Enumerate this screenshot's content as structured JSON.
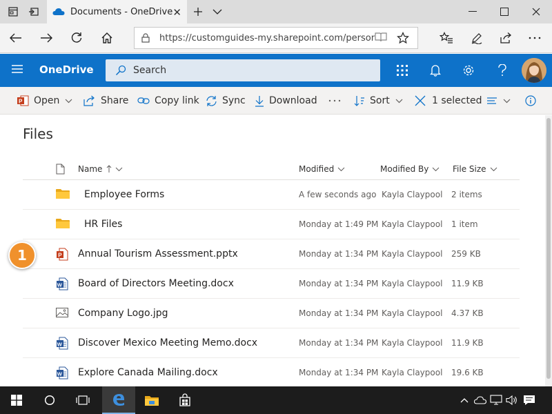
{
  "browser": {
    "tab_title": "Documents - OneDrive",
    "url": "https://customguides-my.sharepoint.com/personal/s"
  },
  "suite": {
    "app_name": "OneDrive",
    "search_placeholder": "Search"
  },
  "commands": {
    "open": "Open",
    "share": "Share",
    "copy_link": "Copy link",
    "sync": "Sync",
    "download": "Download",
    "sort": "Sort",
    "selected": "1 selected"
  },
  "page": {
    "title": "Files"
  },
  "columns": {
    "name": "Name",
    "modified": "Modified",
    "modified_by": "Modified By",
    "file_size": "File Size"
  },
  "files": [
    {
      "name": "Employee Forms",
      "modified": "A few seconds ago",
      "by": "Kayla Claypool",
      "size": "2 items",
      "icon": "folder-icon"
    },
    {
      "name": "HR Files",
      "modified": "Monday at 1:49 PM",
      "by": "Kayla Claypool",
      "size": "1 item",
      "icon": "folder-icon"
    },
    {
      "name": "Annual Tourism Assessment.pptx",
      "modified": "Monday at 1:34 PM",
      "by": "Kayla Claypool",
      "size": "259 KB",
      "icon": "powerpoint-file-icon"
    },
    {
      "name": "Board of Directors Meeting.docx",
      "modified": "Monday at 1:34 PM",
      "by": "Kayla Claypool",
      "size": "11.9 KB",
      "icon": "word-file-icon"
    },
    {
      "name": "Company Logo.jpg",
      "modified": "Monday at 1:34 PM",
      "by": "Kayla Claypool",
      "size": "4.37 KB",
      "icon": "image-file-icon"
    },
    {
      "name": "Discover Mexico Meeting Memo.docx",
      "modified": "Monday at 1:34 PM",
      "by": "Kayla Claypool",
      "size": "11.9 KB",
      "icon": "word-file-icon"
    },
    {
      "name": "Explore Canada Mailing.docx",
      "modified": "Monday at 1:34 PM",
      "by": "Kayla Claypool",
      "size": "19.6 KB",
      "icon": "word-file-icon"
    }
  ],
  "callout": {
    "number": "1"
  },
  "colors": {
    "suite_blue": "#0e72c9",
    "accent_orange": "#f0912c",
    "folder_yellow": "#ffc83d",
    "word_blue": "#2b579a",
    "ppt_red": "#c43e1c"
  }
}
